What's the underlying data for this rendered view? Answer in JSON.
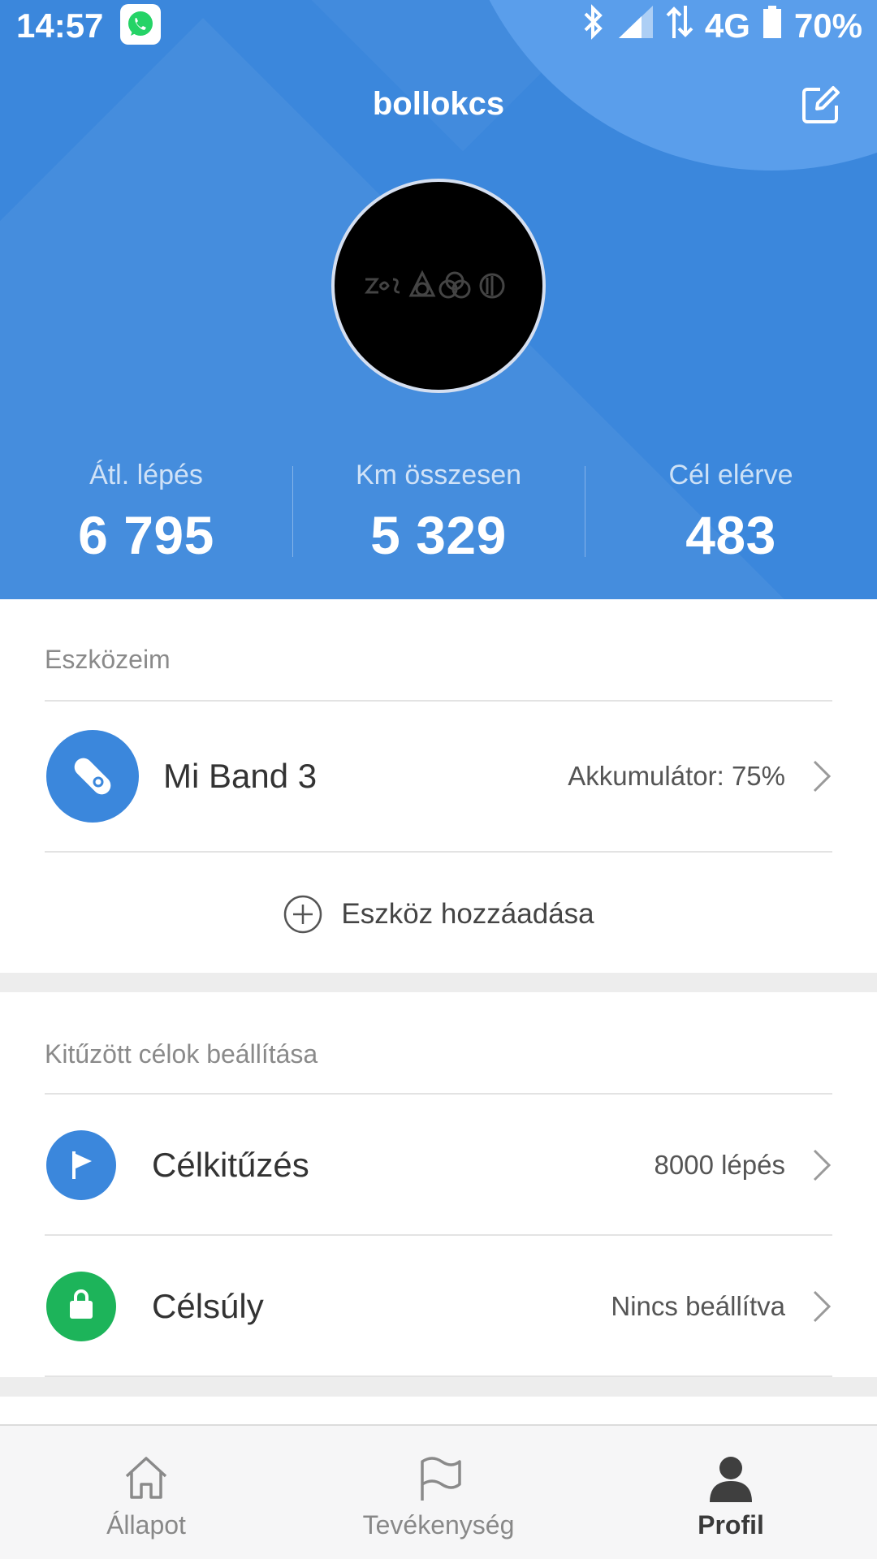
{
  "status_bar": {
    "time": "14:57",
    "network": "4G",
    "battery": "70%"
  },
  "header": {
    "username": "bollokcs",
    "stats": [
      {
        "label": "Átl. lépés",
        "value": "6 795"
      },
      {
        "label": "Km összesen",
        "value": "5 329"
      },
      {
        "label": "Cél elérve",
        "value": "483"
      }
    ]
  },
  "devices": {
    "title": "Eszközeim",
    "items": [
      {
        "name": "Mi Band 3",
        "status": "Akkumulátor: 75%"
      }
    ],
    "add_label": "Eszköz hozzáadása"
  },
  "goals": {
    "title": "Kitűzött célok beállítása",
    "items": [
      {
        "label": "Célkitűzés",
        "value": "8000 lépés",
        "icon": "flag-icon",
        "color": "#3b87dc"
      },
      {
        "label": "Célsúly",
        "value": "Nincs beállítva",
        "icon": "bag-icon",
        "color": "#1db45a"
      }
    ]
  },
  "bottom_nav": {
    "items": [
      {
        "label": "Állapot",
        "icon": "home-icon"
      },
      {
        "label": "Tevékenység",
        "icon": "flag-icon"
      },
      {
        "label": "Profil",
        "icon": "person-icon",
        "active": true
      }
    ]
  },
  "colors": {
    "header_blue": "#3b87dc",
    "accent_blue": "#3b87dc",
    "green": "#1db45a"
  }
}
